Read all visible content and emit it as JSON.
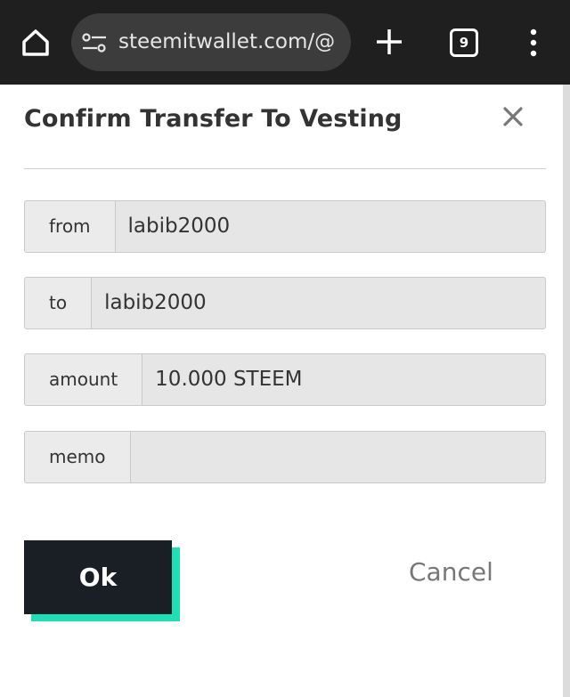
{
  "browser": {
    "url": "steemitwallet.com/@",
    "tab_count": "9",
    "icons": [
      "home-icon",
      "site-settings-icon",
      "new-tab-icon",
      "tab-switcher-icon",
      "overflow-menu-icon"
    ]
  },
  "dialog": {
    "title": "Confirm Transfer To Vesting",
    "close_icon": "close-icon",
    "fields": {
      "from": {
        "label": "from",
        "value": "labib2000"
      },
      "to": {
        "label": "to",
        "value": "labib2000"
      },
      "amount": {
        "label": "amount",
        "value": "10.000 STEEM"
      },
      "memo": {
        "label": "memo",
        "value": ""
      }
    },
    "ok_label": "Ok",
    "cancel_label": "Cancel"
  },
  "colors": {
    "accent": "#1fe0b4",
    "button_dark": "#1a1f26",
    "field_bg": "#e6e6e6",
    "chrome_bg": "#1f1f1f"
  }
}
